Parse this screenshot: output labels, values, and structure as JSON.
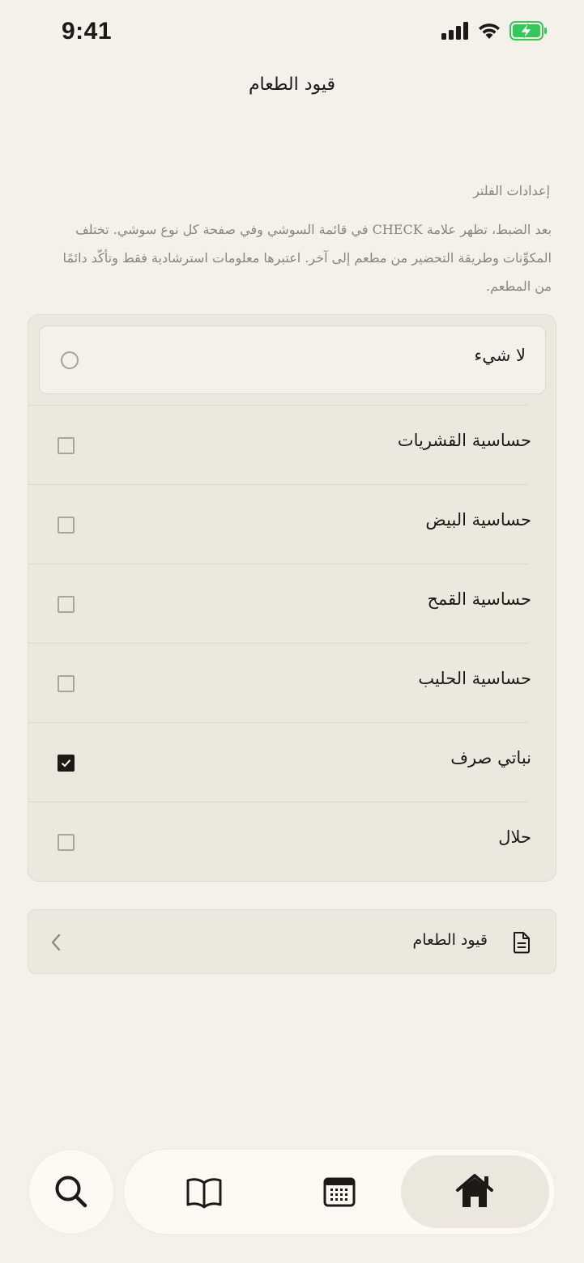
{
  "status_bar": {
    "time": "9:41",
    "icons": [
      "cellular-signal-icon",
      "wifi-icon",
      "battery-charging-icon"
    ],
    "battery_color": "#34c759"
  },
  "nav": {
    "title": "قيود الطعام"
  },
  "filter_section": {
    "label": "إعدادات الفلتر",
    "description": "بعد الضبط، تظهر علامة CHECK في قائمة السوشي وفي صفحة كل نوع سوشي. تختلف المكوِّنات وطريقة التحضير من مطعم إلى آخر. اعتبرها معلومات استرشادية فقط وتأكّد دائمًا من المطعم."
  },
  "options": {
    "none": {
      "label": "لا شيء",
      "selected": false
    },
    "items": [
      {
        "label": "حساسية القشريات",
        "checked": false
      },
      {
        "label": "حساسية البيض",
        "checked": false
      },
      {
        "label": "حساسية القمح",
        "checked": false
      },
      {
        "label": "حساسية الحليب",
        "checked": false
      },
      {
        "label": "نباتي صرف",
        "checked": true
      },
      {
        "label": "حلال",
        "checked": false
      }
    ]
  },
  "link_row": {
    "label": "قيود الطعام",
    "icon": "document-icon",
    "chevron": "chevron-left-icon"
  },
  "tab_bar": {
    "search_icon": "search-icon",
    "tabs": [
      {
        "icon": "book-icon",
        "active": false
      },
      {
        "icon": "calendar-icon",
        "active": false
      },
      {
        "icon": "home-icon",
        "active": true
      }
    ]
  },
  "colors": {
    "background": "#f4f1ea",
    "card": "#ece8de",
    "text": "#1c1a17",
    "muted": "#8a857c"
  }
}
